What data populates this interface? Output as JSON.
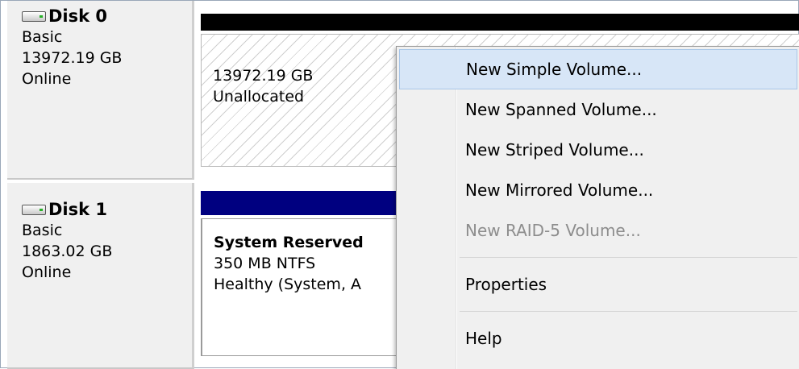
{
  "disks": [
    {
      "name": "Disk 0",
      "type": "Basic",
      "size": "13972.19 GB",
      "status": "Online",
      "partition": {
        "size": "13972.19 GB",
        "label": "Unallocated"
      }
    },
    {
      "name": "Disk 1",
      "type": "Basic",
      "size": "1863.02 GB",
      "status": "Online",
      "partition": {
        "name": "System Reserved",
        "detail": "350 MB NTFS",
        "health": "Healthy (System, A"
      }
    }
  ],
  "context_menu": {
    "items": [
      {
        "label": "New Simple Volume...",
        "state": "highlighted"
      },
      {
        "label": "New Spanned Volume...",
        "state": "enabled"
      },
      {
        "label": "New Striped Volume...",
        "state": "enabled"
      },
      {
        "label": "New Mirrored Volume...",
        "state": "enabled"
      },
      {
        "label": "New RAID-5 Volume...",
        "state": "disabled"
      },
      {
        "label": "Properties",
        "state": "enabled"
      },
      {
        "label": "Help",
        "state": "enabled"
      }
    ]
  },
  "colors": {
    "disk0_header": "#000000",
    "disk1_header": "#000080",
    "menu_highlight": "#d7e6f7",
    "disabled_text": "#8d8d8d"
  },
  "icons": {
    "disk": "hard-disk-icon"
  }
}
